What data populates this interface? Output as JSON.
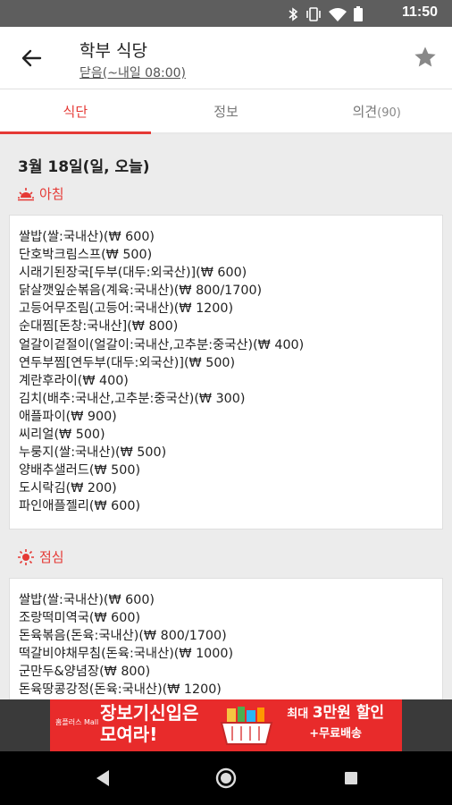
{
  "status_bar": {
    "time": "11:50",
    "icons": [
      "bluetooth-icon",
      "vibrate-icon",
      "wifi-icon",
      "battery-icon"
    ]
  },
  "app_bar": {
    "title": "학부 식당",
    "subtitle": "닫음(~내일 08:00)",
    "back_icon": "arrow-back-icon",
    "favorite_icon": "star-icon"
  },
  "tabs": [
    {
      "label": "식단",
      "count": "",
      "active": true
    },
    {
      "label": "정보",
      "count": "",
      "active": false
    },
    {
      "label": "의견",
      "count": "(90)",
      "active": false
    }
  ],
  "accent_color": "#e53935",
  "date": "3월 18일(일, 오늘)",
  "meals": [
    {
      "name": "아침",
      "icon": "sunrise-icon",
      "items": [
        "쌀밥(쌀:국내산)(₩ 600)",
        "단호박크림스프(₩ 500)",
        "시래기된장국[두부(대두:외국산)](₩ 600)",
        "닭살깻잎순볶음(계육:국내산)(₩ 800/1700)",
        "고등어무조림(고등어:국내산)(₩ 1200)",
        "순대찜[돈창:국내산](₩ 800)",
        "얼갈이겉절이(얼갈이:국내산,고추분:중국산)(₩ 400)",
        "연두부찜[연두부(대두:외국산)](₩ 500)",
        "계란후라이(₩ 400)",
        "김치(배추:국내산,고추분:중국산)(₩ 300)",
        "애플파이(₩ 900)",
        "씨리얼(₩ 500)",
        "누룽지(쌀:국내산)(₩ 500)",
        "양배추샐러드(₩ 500)",
        "도시락김(₩ 200)",
        "파인애플젤리(₩ 600)"
      ]
    },
    {
      "name": "점심",
      "icon": "sun-icon",
      "items": [
        "쌀밥(쌀:국내산)(₩ 600)",
        "조랑떡미역국(₩ 600)",
        "돈육볶음(돈육:국내산)(₩ 800/1700)",
        "떡갈비야채무침(돈육:국내산)(₩ 1000)",
        "군만두&양념장(₩ 800)",
        "돈육땅콩강정(돈육:국내산)(₩ 1200)"
      ]
    }
  ],
  "ad": {
    "brand": "홈플러스 Mall",
    "headline_1": "장보기신입은",
    "headline_2": "모여라!",
    "promo_1_prefix": "최대",
    "promo_1_big": "3만원 할인",
    "promo_2": "+무료배송"
  },
  "nav": [
    "back-triangle-icon",
    "home-circle-icon",
    "recents-square-icon"
  ]
}
